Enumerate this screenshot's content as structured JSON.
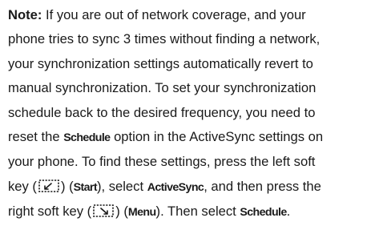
{
  "note": {
    "lead": "Note:",
    "line1": " If you are out of network coverage, and your",
    "line2": "phone tries to sync 3 times without finding a network,",
    "line3": "your synchronization settings automatically revert to",
    "line4": "manual synchronization. To set your synchronization",
    "line5": "schedule back to the desired frequency, you need to",
    "line6_a": "reset the ",
    "schedule_term": "Schedule",
    "line6_b": " option in the ActiveSync settings on",
    "line7": "your phone. To find these settings, press the left soft",
    "line8_a": "key (",
    "line8_b": ") (",
    "start_term": "Start",
    "line8_c": "), select ",
    "activesync_term": "ActiveSync",
    "line8_d": ", and then press the",
    "line9_a": "right soft key (",
    "line9_b": ") (",
    "menu_term": "Menu",
    "line9_c": "). Then select ",
    "schedule_term_2": "Schedule",
    "line9_d": "."
  },
  "icons": {
    "left_softkey": "left-soft-key-icon",
    "right_softkey": "right-soft-key-icon"
  }
}
